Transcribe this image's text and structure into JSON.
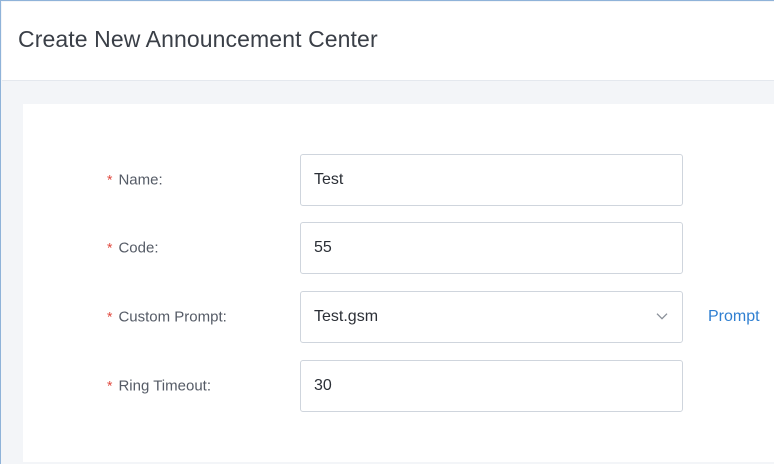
{
  "header": {
    "title": "Create New Announcement Center"
  },
  "form": {
    "required_marker": "*",
    "name": {
      "label": "Name:",
      "value": "Test"
    },
    "code": {
      "label": "Code:",
      "value": "55"
    },
    "custom_prompt": {
      "label": "Custom Prompt:",
      "selected": "Test.gsm",
      "link_label": "Prompt"
    },
    "ring_timeout": {
      "label": "Ring Timeout:",
      "value": "30"
    }
  },
  "colors": {
    "required": "#e0453a",
    "link": "#2f7fd1",
    "border": "#cfd5dd"
  },
  "icons": {
    "dropdown": "chevron-down-icon"
  }
}
